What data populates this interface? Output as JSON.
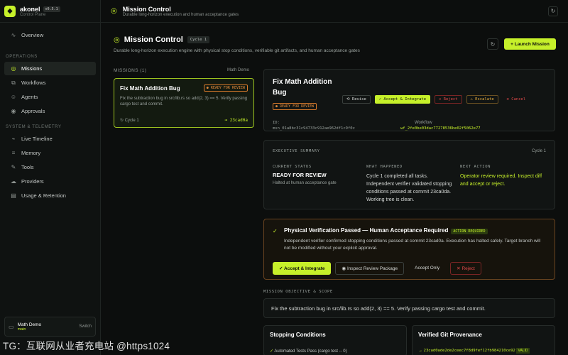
{
  "brand": {
    "name": "akonel",
    "version": "v0.5.1",
    "subtitle": "Control Plane"
  },
  "sidebar": {
    "overview": "Overview",
    "sections": [
      {
        "label": "OPERATIONS",
        "items": [
          "Missions",
          "Workflows",
          "Agents",
          "Approvals"
        ]
      },
      {
        "label": "SYSTEM & TELEMETRY",
        "items": [
          "Live Timeline",
          "Memory",
          "Tools",
          "Providers",
          "Usage & Retention"
        ]
      }
    ],
    "workspace": {
      "name": "Math Demo",
      "branch": "main",
      "switch": "Switch"
    }
  },
  "topbar": {
    "title": "Mission Control",
    "subtitle": "Durable long-horizon execution and human acceptance gates"
  },
  "header": {
    "title": "Mission Control",
    "cycle": "Cycle 1",
    "subtitle": "Durable long-horizon execution engine with physical stop conditions, verifiable git artifacts, and human acceptance gates",
    "launch": "+ Launch Mission"
  },
  "missions": {
    "label": "MISSIONS (1)",
    "demo": "Math Demo",
    "card": {
      "title": "Fix Math Addition Bug",
      "status": "READY FOR REVIEW",
      "desc": "Fix the subtraction bug in src/lib.rs so add(2, 3) == 5. Verify passing cargo test and commit.",
      "cycle": "Cycle 1",
      "hash": "23cad0a"
    }
  },
  "detail": {
    "title": "Fix Math Addition Bug",
    "status": "READY FOR REVIEW",
    "actions": [
      "Revise",
      "Accept & Integrate",
      "Reject",
      "Escalate",
      "Cancel"
    ],
    "id_label": "ID:",
    "id_value": "msn_01a8bc31c94733c912ae962df1c9f0c",
    "workflow_label": "Workflow",
    "workflow_value": "wf_2fe0be03dac77278536be02f5062e77"
  },
  "summary": {
    "label": "EXECUTIVE SUMMARY",
    "cycle": "Cycle 1",
    "current_status_label": "CURRENT STATUS",
    "current_status": "READY FOR REVIEW",
    "current_status_note": "Halted at human acceptance gate",
    "what_happened_label": "WHAT HAPPENED",
    "what_happened": "Cycle 1 completed all tasks. Independent verifier validated stopping conditions passed at commit 23ca0da. Working tree is clean.",
    "next_action_label": "NEXT ACTION",
    "next_action": "Operator review required. Inspect diff and accept or reject."
  },
  "verification": {
    "title": "Physical Verification Passed — Human Acceptance Required",
    "tag": "ACTION REQUIRED",
    "desc": "Independent verifier confirmed stopping conditions passed at commit 23cad0a. Execution has halted safely. Target branch will not be modified without your explicit approval.",
    "buttons": [
      "Accept & Integrate",
      "Inspect Review Package",
      "Accept Only",
      "Reject"
    ]
  },
  "objective": {
    "label": "MISSION OBJECTIVE & SCOPE",
    "text": "Fix the subtraction bug in src/lib.rs so add(2, 3) == 5. Verify passing cargo test and commit."
  },
  "stopping": {
    "title": "Stopping Conditions",
    "row": "Automated Tests Pass (cargo test -- 0)"
  },
  "provenance": {
    "title": "Verified Git Provenance",
    "row": "23cad0ade2de2ceec7f8d9fef12fb984210ce92",
    "tag": "VALID"
  },
  "watermark": "TG：互联网从业者充电站 @https1024",
  "colors": {
    "accent": "#c6f02a",
    "warning": "#e0893a",
    "danger": "#e04a4a",
    "bg": "#0c0e0d"
  }
}
